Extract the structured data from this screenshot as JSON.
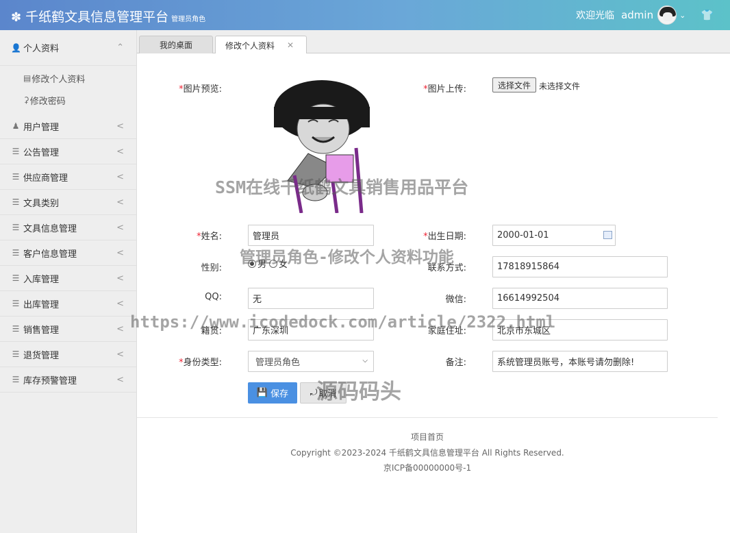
{
  "header": {
    "brand_icon": "gear-icon",
    "title": "千纸鹤文具信息管理平台",
    "subtitle": "管理员角色",
    "welcome": "欢迎光临",
    "username": "admin",
    "gradient_start": "#5b86cc",
    "gradient_end": "#5cc2c9"
  },
  "sidebar": {
    "items": [
      {
        "label": "个人资料",
        "icon": "user-icon",
        "expanded": true,
        "children": [
          {
            "label": "修改个人资料",
            "icon": "form-icon"
          },
          {
            "label": "修改密码",
            "icon": "key-icon"
          }
        ]
      },
      {
        "label": "用户管理",
        "icon": "users-icon"
      },
      {
        "label": "公告管理",
        "icon": "list-icon"
      },
      {
        "label": "供应商管理",
        "icon": "list-icon"
      },
      {
        "label": "文具类别",
        "icon": "list-icon"
      },
      {
        "label": "文具信息管理",
        "icon": "list-icon"
      },
      {
        "label": "客户信息管理",
        "icon": "list-icon"
      },
      {
        "label": "入库管理",
        "icon": "list-icon"
      },
      {
        "label": "出库管理",
        "icon": "list-icon"
      },
      {
        "label": "销售管理",
        "icon": "list-icon"
      },
      {
        "label": "退货管理",
        "icon": "list-icon"
      },
      {
        "label": "库存预警管理",
        "icon": "list-icon"
      }
    ]
  },
  "tabs": [
    {
      "label": "我的桌面"
    },
    {
      "label": "修改个人资料",
      "active": true
    }
  ],
  "form": {
    "image_preview_label": "图片预览:",
    "image_upload_label": "图片上传:",
    "file_button": "选择文件",
    "file_status": "未选择文件",
    "name_label": "姓名:",
    "name_value": "管理员",
    "birth_label": "出生日期:",
    "birth_value": "2000-01-01",
    "gender_label": "性别:",
    "gender_options": [
      "男",
      "女"
    ],
    "gender_selected": "男",
    "contact_label": "联系方式:",
    "contact_value": "17818915864",
    "qq_label": "QQ:",
    "qq_value": "无",
    "wechat_label": "微信:",
    "wechat_value": "16614992504",
    "native_label": "籍贯:",
    "native_value": "广东深圳",
    "address_label": "家庭住址:",
    "address_value": "北京市东城区",
    "idtype_label": "身份类型:",
    "idtype_value": "管理员角色",
    "remark_label": "备注:",
    "remark_value": "系统管理员账号，本账号请勿删除!",
    "save_button": "保存",
    "cancel_button": "取消",
    "accent_color": "#4a90e2"
  },
  "footer": {
    "home_link": "项目首页",
    "copyright": "Copyright ©2023-2024 千纸鹤文具信息管理平台 All Rights Reserved.",
    "icp": "京ICP备00000000号-1"
  },
  "watermarks": {
    "line1": "SSM在线千纸鹤文具销售用品平台",
    "line2": "管理员角色-修改个人资料功能",
    "line3": "https://www.icodedock.com/article/2322.html",
    "line4": "源码码头"
  }
}
